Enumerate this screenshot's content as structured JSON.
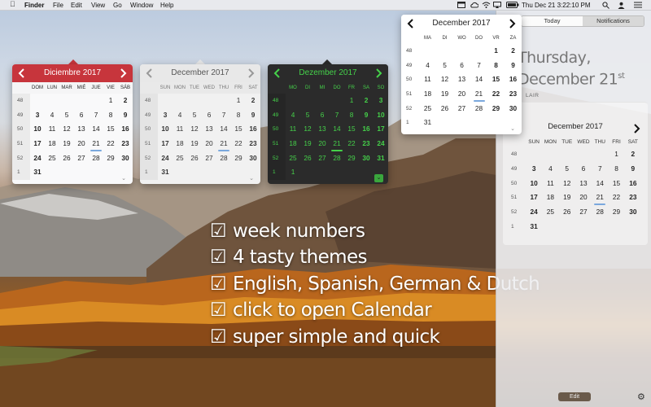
{
  "menubar": {
    "app_name": "Finder",
    "menus": [
      "File",
      "Edit",
      "View",
      "Go",
      "Window",
      "Help"
    ],
    "clock": "Thu Dec 21   3:22:10 PM",
    "icons": [
      "apple-icon",
      "calendar-menubar-icon",
      "cloud-icon",
      "wifi-icon",
      "airplay-icon",
      "battery-icon",
      "search-icon",
      "user-icon",
      "list-icon"
    ]
  },
  "calendars": {
    "spanish": {
      "theme": "red",
      "month": "Diciembre 2017",
      "weekdays": [
        "DOM",
        "LUN",
        "MAR",
        "MIÉ",
        "JUE",
        "VIE",
        "SÁB"
      ],
      "weeks": [
        "48",
        "49",
        "50",
        "51",
        "52",
        "1"
      ],
      "rows": [
        [
          "",
          "",
          "",
          "",
          "",
          "1",
          "2"
        ],
        [
          "3",
          "4",
          "5",
          "6",
          "7",
          "8",
          "9"
        ],
        [
          "10",
          "11",
          "12",
          "13",
          "14",
          "15",
          "16"
        ],
        [
          "17",
          "18",
          "19",
          "20",
          "21",
          "22",
          "23"
        ],
        [
          "24",
          "25",
          "26",
          "27",
          "28",
          "29",
          "30"
        ],
        [
          "31",
          "",
          "",
          "",
          "",
          "",
          ""
        ]
      ]
    },
    "english_light": {
      "theme": "light",
      "month": "December 2017",
      "weekdays": [
        "SUN",
        "MON",
        "TUE",
        "WED",
        "THU",
        "FRI",
        "SAT"
      ],
      "weeks": [
        "48",
        "49",
        "50",
        "51",
        "52",
        "1"
      ],
      "rows": [
        [
          "",
          "",
          "",
          "",
          "",
          "1",
          "2"
        ],
        [
          "3",
          "4",
          "5",
          "6",
          "7",
          "8",
          "9"
        ],
        [
          "10",
          "11",
          "12",
          "13",
          "14",
          "15",
          "16"
        ],
        [
          "17",
          "18",
          "19",
          "20",
          "21",
          "22",
          "23"
        ],
        [
          "24",
          "25",
          "26",
          "27",
          "28",
          "29",
          "30"
        ],
        [
          "31",
          "",
          "",
          "",
          "",
          "",
          ""
        ]
      ]
    },
    "german_dark": {
      "theme": "dark",
      "month": "Dezember 2017",
      "weekdays": [
        "MO",
        "DI",
        "MI",
        "DO",
        "FR",
        "SA",
        "SO"
      ],
      "weeks": [
        "48",
        "49",
        "50",
        "51",
        "52",
        "1"
      ],
      "rows": [
        [
          "",
          "",
          "",
          "",
          "1",
          "2",
          "3"
        ],
        [
          "4",
          "5",
          "6",
          "7",
          "8",
          "9",
          "10"
        ],
        [
          "11",
          "12",
          "13",
          "14",
          "15",
          "16",
          "17"
        ],
        [
          "18",
          "19",
          "20",
          "21",
          "22",
          "23",
          "24"
        ],
        [
          "25",
          "26",
          "27",
          "28",
          "29",
          "30",
          "31"
        ],
        [
          "1",
          "",
          "",
          "",
          "",
          "",
          ""
        ]
      ]
    },
    "dutch_white": {
      "theme": "white",
      "month": "December 2017",
      "weekdays": [
        "MA",
        "DI",
        "WO",
        "DO",
        "VR",
        "ZA"
      ],
      "weeks": [
        "48",
        "49",
        "50",
        "51",
        "52",
        "1"
      ],
      "rows": [
        [
          "",
          "",
          "",
          "",
          "1",
          "2"
        ],
        [
          "4",
          "5",
          "6",
          "7",
          "8",
          "9"
        ],
        [
          "11",
          "12",
          "13",
          "14",
          "15",
          "16"
        ],
        [
          "18",
          "19",
          "20",
          "21",
          "22",
          "23"
        ],
        [
          "25",
          "26",
          "27",
          "28",
          "29",
          "30"
        ],
        [
          "31",
          "",
          "",
          "",
          "",
          ""
        ]
      ]
    }
  },
  "features": [
    "week numbers",
    "4 tasty themes",
    "English, Spanish, German & Dutch",
    "click to open Calendar",
    "super simple and quick"
  ],
  "checkbox_glyph": "☑",
  "notification_center": {
    "tabs": [
      "Today",
      "Notifications"
    ],
    "day": "Thursday,",
    "date": "December 21",
    "date_suffix": "st",
    "widget_label": "LAIR",
    "widget": {
      "month": "December 2017",
      "weekdays": [
        "SUN",
        "MON",
        "TUE",
        "WED",
        "THU",
        "FRI",
        "SAT"
      ],
      "weeks": [
        "48",
        "49",
        "50",
        "51",
        "52",
        "1"
      ],
      "rows": [
        [
          "",
          "",
          "",
          "",
          "",
          "1",
          "2"
        ],
        [
          "3",
          "4",
          "5",
          "6",
          "7",
          "8",
          "9"
        ],
        [
          "10",
          "11",
          "12",
          "13",
          "14",
          "15",
          "16"
        ],
        [
          "17",
          "18",
          "19",
          "20",
          "21",
          "22",
          "23"
        ],
        [
          "24",
          "25",
          "26",
          "27",
          "28",
          "29",
          "30"
        ],
        [
          "31",
          "",
          "",
          "",
          "",
          "",
          ""
        ]
      ]
    },
    "edit_label": "Edit"
  },
  "colors": {
    "red_header": "#c7353c",
    "green_text": "#45d14a",
    "today_marker": "#7aa8dd"
  }
}
